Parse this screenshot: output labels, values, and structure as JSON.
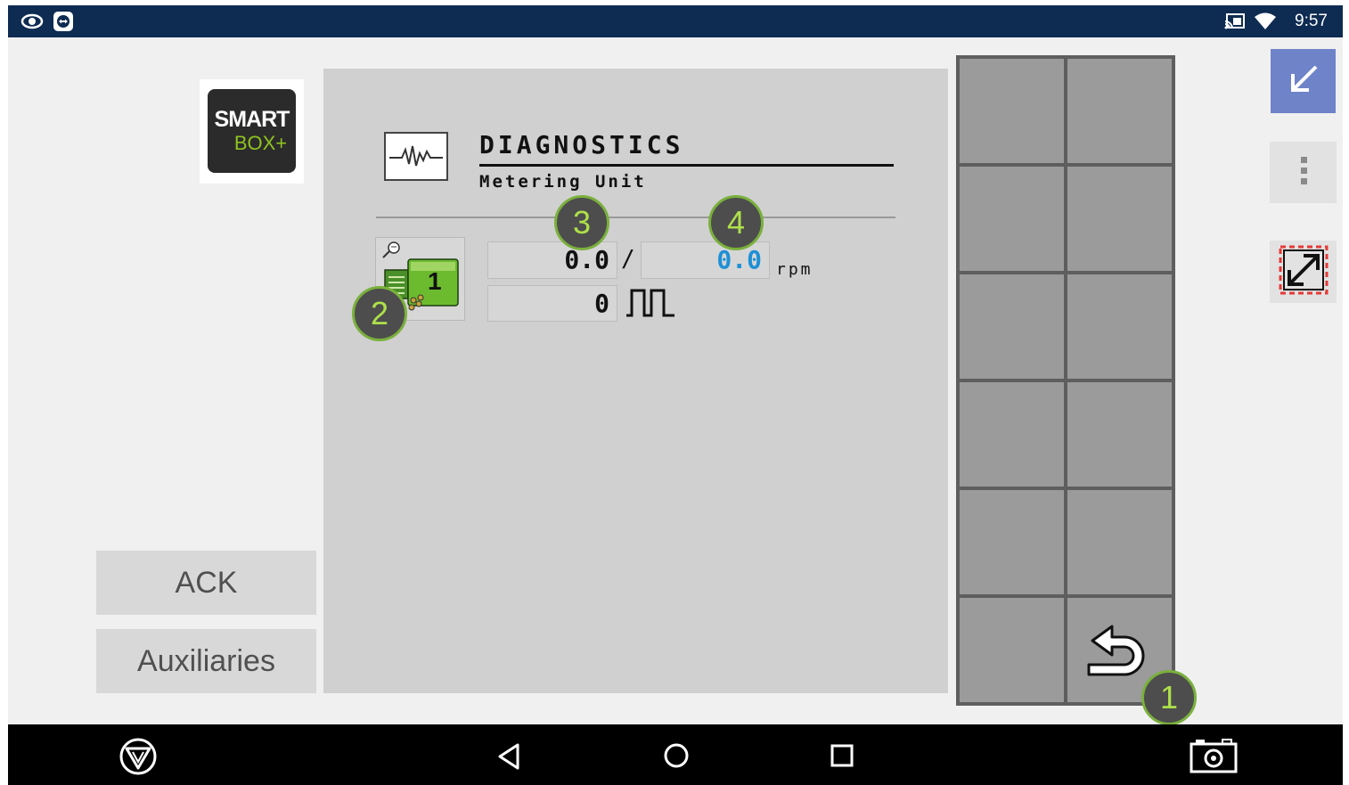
{
  "status_bar": {
    "left_icons": [
      "eye-icon",
      "teamviewer-icon"
    ],
    "right_icons": [
      "cast-icon",
      "wifi-icon"
    ],
    "time": "9:57"
  },
  "logo": {
    "line1": "SMART",
    "line2": "BOX+"
  },
  "side_buttons": {
    "ack_label": "ACK",
    "auxiliaries_label": "Auxiliaries"
  },
  "panel": {
    "title": "DIAGNOSTICS",
    "subtitle": "Metering Unit",
    "metering_button": {
      "icon": "metering-unit-icon",
      "number": "1"
    },
    "actual_speed": "0.0",
    "divider": "/",
    "target_speed": "0.0",
    "unit": "rpm",
    "pulses": "0",
    "pulse_icon": "pulse-icon"
  },
  "softkeys": {
    "back_icon": "return-icon"
  },
  "right_controls": {
    "minimize_icon": "arrow-down-left-icon",
    "menu_icon": "more-vert-icon",
    "resize_icon": "resize-icon",
    "colors": {
      "minimize_bg": "#6f83c9",
      "resize_border": "#e53935"
    }
  },
  "callouts": [
    "1",
    "2",
    "3",
    "4"
  ],
  "nav_bar": {
    "icons": [
      "logo-triangle-icon",
      "back-icon",
      "home-icon",
      "recents-icon",
      "camera-icon"
    ]
  },
  "colors": {
    "target_value": "#1e90d6",
    "callout_border": "#7ab03c",
    "callout_text": "#aee04a",
    "status_bar": "#0e2b52"
  }
}
